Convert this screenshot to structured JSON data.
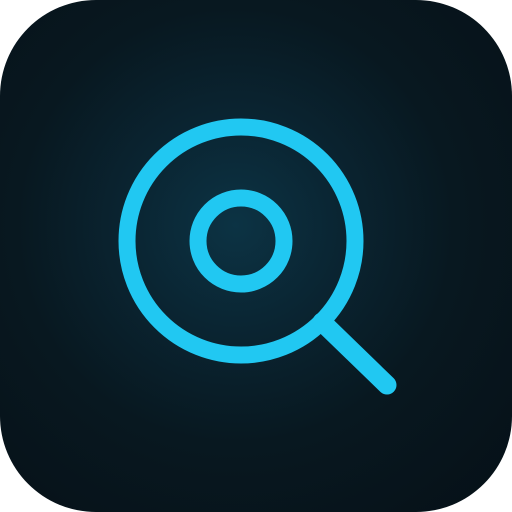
{
  "app_icon": {
    "name": "search-app-icon",
    "glyph_icon": "magnifier-with-inner-ring-icon",
    "colors": {
      "background_center": "#0c3344",
      "background_edge": "#061017",
      "glyph_stroke": "#21c8f2",
      "frame": "#ffffff"
    }
  }
}
